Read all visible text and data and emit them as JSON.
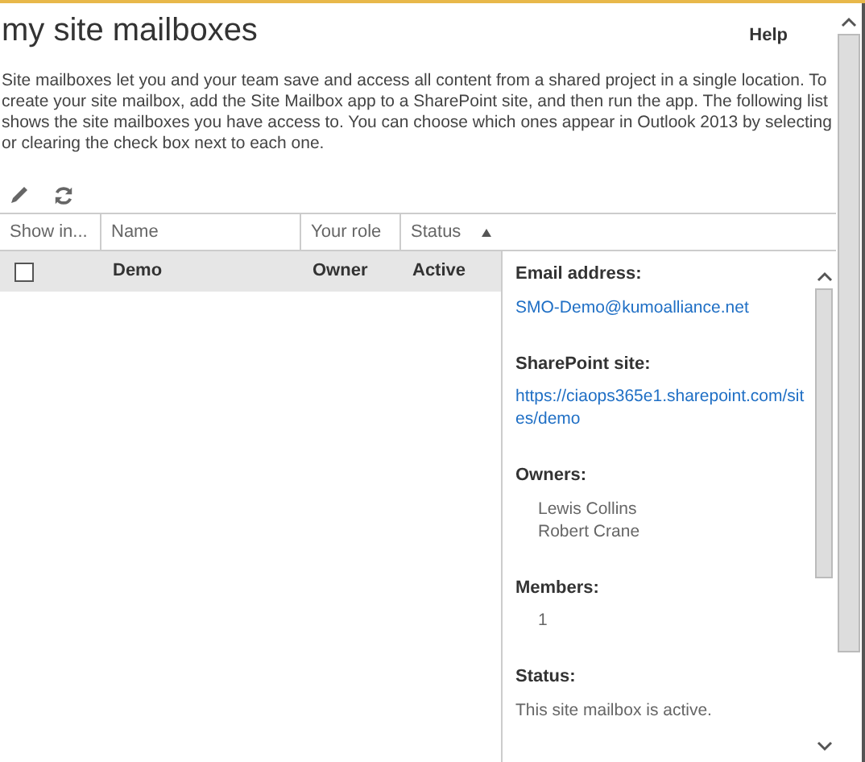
{
  "title": "my site mailboxes",
  "help": "Help",
  "description": "Site mailboxes let you and your team save and access all content from a shared project in a single location. To create your site mailbox, add the Site Mailbox app to a SharePoint site, and then run the app. The following list shows the site mailboxes you have access to. You can choose which ones appear in Outlook 2013 by selecting or clearing the check box next to each one.",
  "table": {
    "columns": [
      {
        "label": "Show in...",
        "sorted": false
      },
      {
        "label": "Name",
        "sorted": false
      },
      {
        "label": "Your role",
        "sorted": false
      },
      {
        "label": "Status",
        "sorted": true
      }
    ],
    "rows": [
      {
        "checked": false,
        "selected": true,
        "name": "Demo",
        "role": "Owner",
        "status": "Active"
      }
    ]
  },
  "details": [
    {
      "label": "Email address:",
      "kind": "link",
      "values": [
        "SMO-Demo@kumoalliance.net"
      ]
    },
    {
      "label": "SharePoint site:",
      "kind": "link",
      "values": [
        "https://ciaops365e1.sharepoint.com/sites/demo"
      ]
    },
    {
      "label": "Owners:",
      "kind": "list",
      "values": [
        "Lewis Collins",
        "Robert Crane"
      ]
    },
    {
      "label": "Members:",
      "kind": "list",
      "values": [
        "1"
      ]
    },
    {
      "label": "Status:",
      "kind": "text",
      "values": [
        "This site mailbox is active."
      ]
    }
  ]
}
